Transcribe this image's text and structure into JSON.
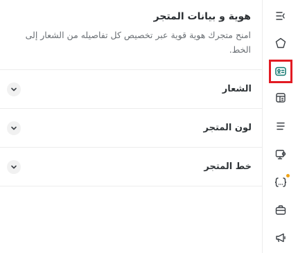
{
  "panel": {
    "title": "هوية و بيانات المتجر",
    "description": "امنح متجرك هوية قوية عبر تخصيص كل تفاصيله من الشعار إلى الخط."
  },
  "sections": [
    {
      "label": "الشعار"
    },
    {
      "label": "لون المتجر"
    },
    {
      "label": "خط المتجر"
    }
  ],
  "rail": {
    "items": [
      {
        "icon": "collapse-menu-icon"
      },
      {
        "icon": "home-icon"
      },
      {
        "icon": "id-card-icon",
        "active": true
      },
      {
        "icon": "layout-icon"
      },
      {
        "icon": "lines-icon"
      },
      {
        "icon": "settings-screen-icon"
      },
      {
        "icon": "code-braces-icon",
        "badge": true
      },
      {
        "icon": "briefcase-icon"
      },
      {
        "icon": "megaphone-icon"
      }
    ],
    "accent_color": "#e21b23",
    "badge_color": "#f0a416",
    "active_icon_color": "#0f766e"
  }
}
